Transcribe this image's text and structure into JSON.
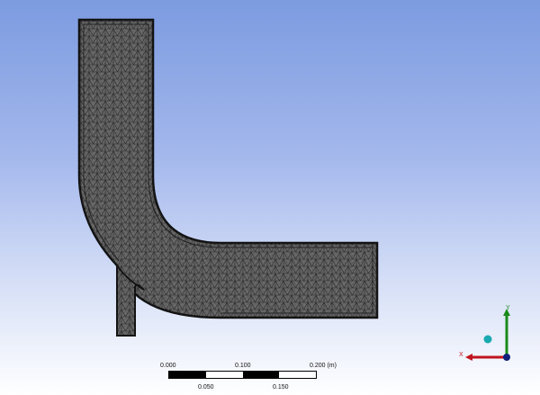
{
  "viewport": {
    "background_top": "#7c9be0",
    "background_bottom": "#ffffff",
    "mesh_color": "#5a5a5a",
    "mesh_line_color": "#1e1e1e"
  },
  "scale": {
    "top_labels": [
      "0.000",
      "0.100",
      "0.200 (m)"
    ],
    "bottom_labels": [
      "0.050",
      "0.150"
    ]
  },
  "triad": {
    "x_label": "X",
    "y_label": "Y",
    "x_color": "#c0141e",
    "y_color": "#1a8a1a",
    "z_color": "#10207a",
    "iso_color": "#1aa9b0"
  }
}
